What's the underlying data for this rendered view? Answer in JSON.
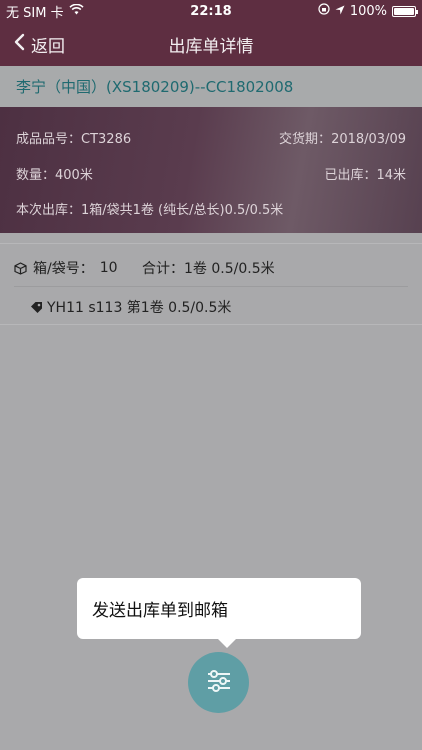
{
  "status_bar": {
    "carrier": "无 SIM 卡",
    "time": "22:18",
    "battery_percent": "100%"
  },
  "nav": {
    "back_label": "返回",
    "title": "出库单详情"
  },
  "order": {
    "customer_line": "李宁（中国）(XS180209)--CC1802008"
  },
  "info": {
    "product_label": "成品品号：",
    "product_value": "CT3286",
    "delivery_label": "交货期：",
    "delivery_value": "2018/03/09",
    "qty_label": "数量：",
    "qty_value": "400米",
    "shipped_label": "已出库：",
    "shipped_value": "14米",
    "current_out": "本次出库：1箱/袋共1卷 (纯长/总长)0.5/0.5米"
  },
  "box": {
    "label": "箱/袋号：",
    "number": "10",
    "total_text": "合计：1卷 0.5/0.5米",
    "roll_text": "YH11 s113  第1卷 0.5/0.5米"
  },
  "popover": {
    "send_label": "发送出库单到邮箱"
  },
  "colors": {
    "nav_bg": "#5e2e41",
    "accent_teal": "#1f6a70",
    "fab": "#5f9ea5"
  }
}
